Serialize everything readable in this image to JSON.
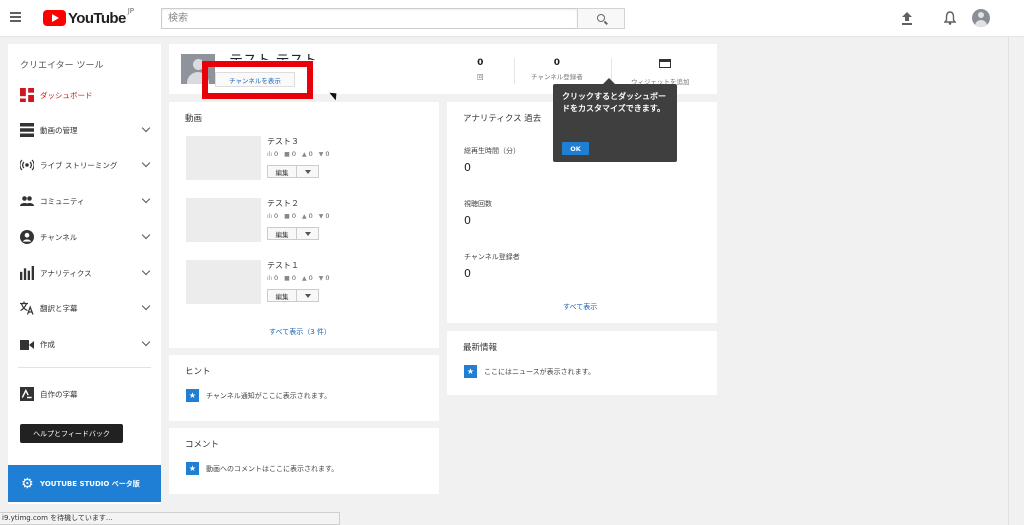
{
  "header": {
    "logo_text": "YouTube",
    "logo_region": "JP",
    "search_placeholder": "検索"
  },
  "sidebar": {
    "title": "クリエイター ツール",
    "items": [
      {
        "label": "ダッシュボード",
        "icon": "dashboard-icon",
        "active": true
      },
      {
        "label": "動画の管理",
        "icon": "video-manager-icon"
      },
      {
        "label": "ライブ ストリーミング",
        "icon": "live-icon"
      },
      {
        "label": "コミュニティ",
        "icon": "community-icon"
      },
      {
        "label": "チャンネル",
        "icon": "channel-icon"
      },
      {
        "label": "アナリティクス",
        "icon": "analytics-icon"
      },
      {
        "label": "翻訳と字幕",
        "icon": "translate-icon"
      },
      {
        "label": "作成",
        "icon": "create-icon"
      }
    ],
    "own_subtitles": "自作の字幕",
    "help_feedback": "ヘルプとフィードバック",
    "studio_beta": "YOUTUBE STUDIO ベータ版"
  },
  "profile": {
    "name": "テスト テスト",
    "channel_button": "チャンネルを表示",
    "stats": [
      {
        "value": "0",
        "label": "回"
      },
      {
        "value": "0",
        "label": "チャンネル登録者"
      }
    ],
    "add_widget": "ウィジェットを追加"
  },
  "videos": {
    "title": "動画",
    "items": [
      {
        "title": "テスト３",
        "views": "0",
        "comments": "0",
        "likes": "0",
        "dislikes": "0"
      },
      {
        "title": "テスト２",
        "views": "0",
        "comments": "0",
        "likes": "0",
        "dislikes": "0"
      },
      {
        "title": "テスト１",
        "views": "0",
        "comments": "0",
        "likes": "0",
        "dislikes": "0"
      }
    ],
    "edit_label": "編集",
    "view_all": "すべて表示（3 件）"
  },
  "analytics": {
    "title": "アナリティクス  過去",
    "metrics": [
      {
        "label": "総再生時間（分）",
        "value": "0"
      },
      {
        "label": "視聴回数",
        "value": "0"
      },
      {
        "label": "チャンネル登録者",
        "value": "0"
      }
    ],
    "view_all": "すべて表示"
  },
  "tooltip": {
    "text": "クリックするとダッシュボードをカスタマイズできます。",
    "ok": "OK"
  },
  "news": {
    "title": "最新情報",
    "empty": "ここにはニュースが表示されます。"
  },
  "hints": {
    "title": "ヒント",
    "empty": "チャンネル通知がここに表示されます。"
  },
  "comments": {
    "title": "コメント",
    "empty": "動画へのコメントはここに表示されます。"
  },
  "status_bar": "i9.ytimg.com を待機しています..."
}
